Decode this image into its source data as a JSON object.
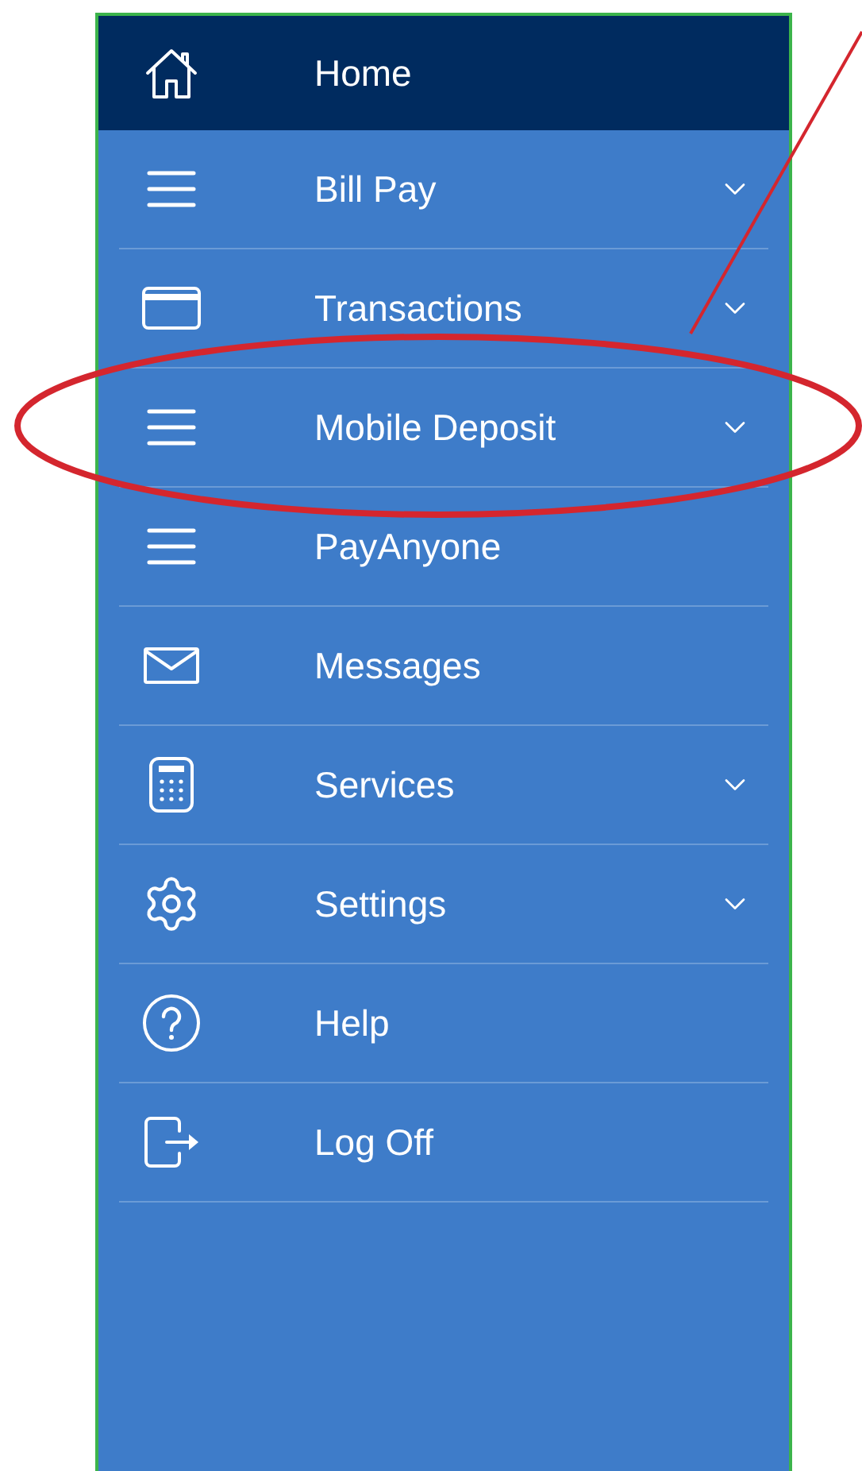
{
  "menu": {
    "items": [
      {
        "label": "Home",
        "selected": true,
        "expandable": false
      },
      {
        "label": "Bill Pay",
        "selected": false,
        "expandable": true
      },
      {
        "label": "Transactions",
        "selected": false,
        "expandable": true
      },
      {
        "label": "Mobile Deposit",
        "selected": false,
        "expandable": true
      },
      {
        "label": "PayAnyone",
        "selected": false,
        "expandable": false
      },
      {
        "label": "Messages",
        "selected": false,
        "expandable": false
      },
      {
        "label": "Services",
        "selected": false,
        "expandable": true
      },
      {
        "label": "Settings",
        "selected": false,
        "expandable": true
      },
      {
        "label": "Help",
        "selected": false,
        "expandable": false
      },
      {
        "label": "Log Off",
        "selected": false,
        "expandable": false
      }
    ]
  }
}
